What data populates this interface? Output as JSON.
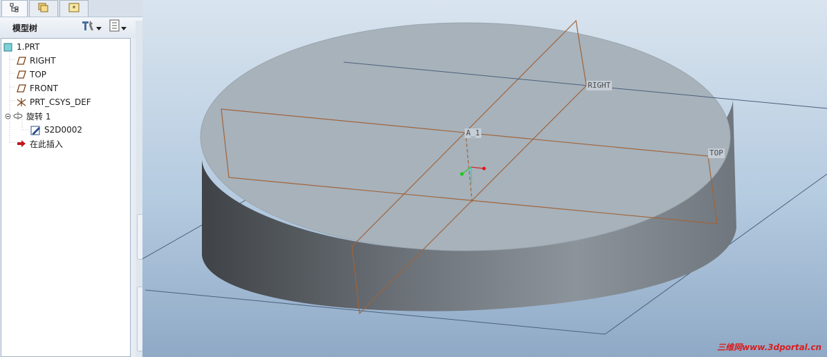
{
  "tabs": [
    {
      "name": "model-tree-tab",
      "icon": "model-tree-icon"
    },
    {
      "name": "folder-browser-tab",
      "icon": "folders-icon"
    },
    {
      "name": "favorites-tab",
      "icon": "star-icon"
    }
  ],
  "tree_header": {
    "title": "模型树",
    "settings_icon": "tools-icon",
    "show_icon": "list-settings-icon"
  },
  "tree": {
    "root": "1.PRT",
    "items": [
      {
        "label": "RIGHT",
        "icon": "datum-plane-icon"
      },
      {
        "label": "TOP",
        "icon": "datum-plane-icon"
      },
      {
        "label": "FRONT",
        "icon": "datum-plane-icon"
      },
      {
        "label": "PRT_CSYS_DEF",
        "icon": "csys-icon"
      },
      {
        "label": "旋转 1",
        "icon": "revolve-icon"
      },
      {
        "label": "S2D0002",
        "icon": "sketch-icon"
      },
      {
        "label": "在此插入",
        "icon": "insert-here-arrow-icon"
      }
    ]
  },
  "viewport": {
    "datum_labels": {
      "right": "RIGHT",
      "top": "TOP",
      "axis": "A_1"
    }
  },
  "watermark": {
    "cn": "三维网",
    "url": "www.3dportal.cn"
  },
  "colors": {
    "datum_plane": "#a0643a",
    "part_surface": "#a7b2bb",
    "insert_arrow": "#c0181e",
    "watermark": "#d81e1e"
  }
}
